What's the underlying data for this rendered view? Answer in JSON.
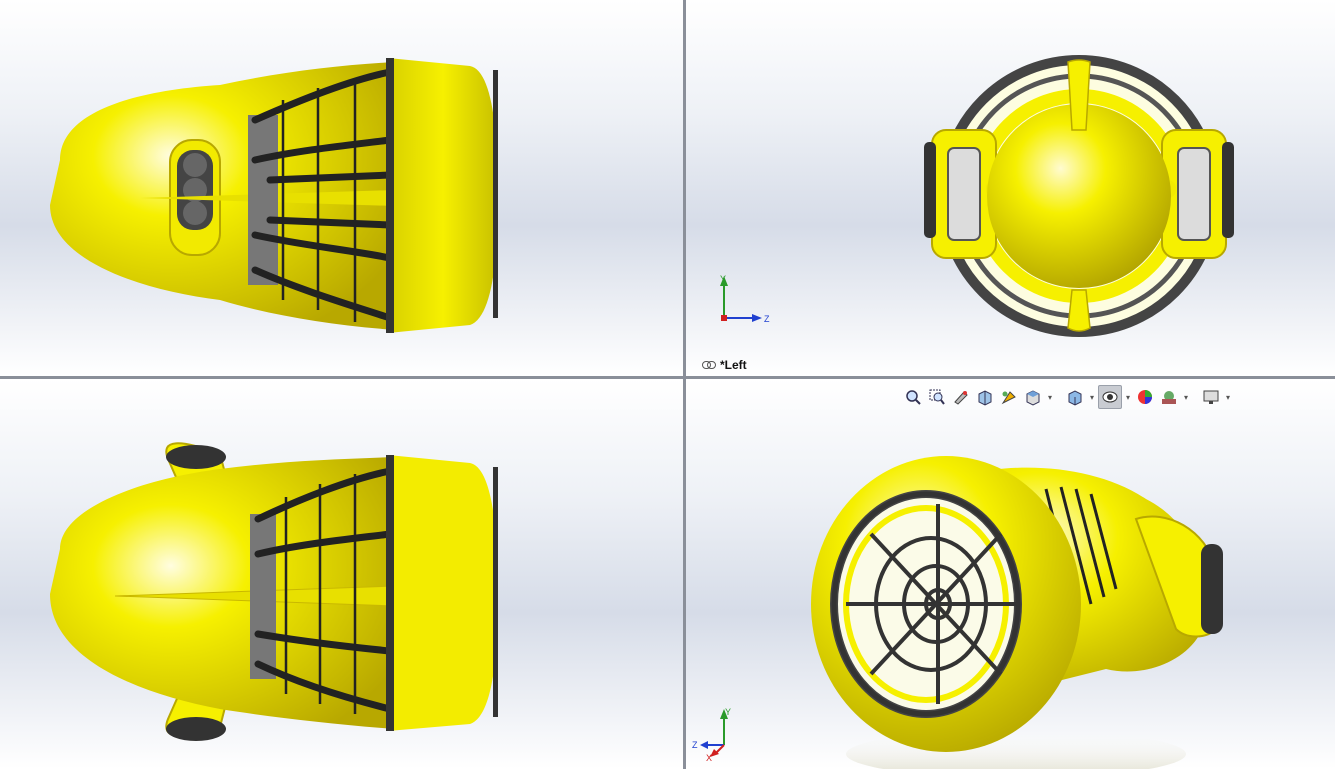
{
  "viewports": {
    "top_left": {
      "view": ""
    },
    "top_right": {
      "view_label": "*Left",
      "triad": {
        "axis_y": "Y",
        "axis_z": "Z"
      }
    },
    "bottom_left": {
      "view": ""
    },
    "bottom_right": {
      "triad": {
        "axis_y": "Y",
        "axis_z": "Z",
        "axis_x": "X"
      }
    }
  },
  "heads_up_toolbar": {
    "tools": [
      {
        "icon": "zoom-to-fit-icon"
      },
      {
        "icon": "zoom-to-area-icon"
      },
      {
        "icon": "previous-view-icon"
      },
      {
        "icon": "section-view-icon"
      },
      {
        "icon": "dynamic-annotation-icon"
      },
      {
        "icon": "view-orientation-icon",
        "dropdown": true
      },
      {
        "icon": "display-style-icon",
        "dropdown": true
      },
      {
        "icon": "hide-show-items-icon",
        "dropdown": true,
        "active": true
      },
      {
        "icon": "edit-appearance-icon"
      },
      {
        "icon": "apply-scene-icon",
        "dropdown": true
      },
      {
        "icon": "view-settings-icon",
        "dropdown": true
      }
    ]
  },
  "colors": {
    "model_body": "#f6f000",
    "model_shadow": "#c9b800",
    "cage": "#2a2a2a",
    "viewport_divider": "#8a8f99",
    "axis_x": "#d02020",
    "axis_y": "#2a9a2a",
    "axis_z": "#2040d0"
  }
}
